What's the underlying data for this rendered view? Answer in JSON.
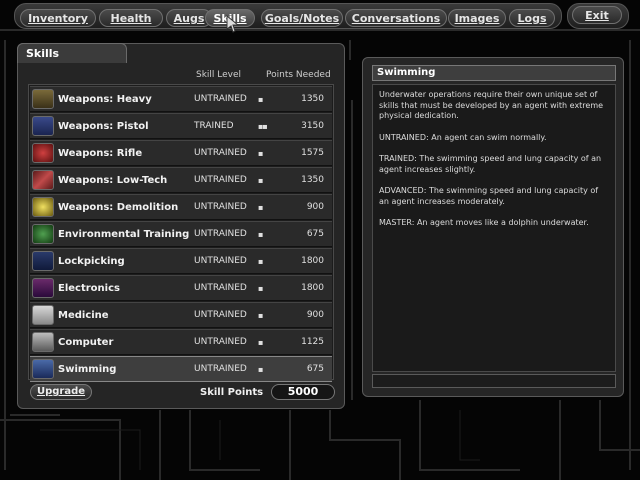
{
  "tabs": [
    {
      "label": "Inventory"
    },
    {
      "label": "Health"
    },
    {
      "label": "Augs"
    },
    {
      "label": "Skills"
    },
    {
      "label": "Goals/Notes"
    },
    {
      "label": "Conversations"
    },
    {
      "label": "Images"
    },
    {
      "label": "Logs"
    }
  ],
  "exit_label": "Exit",
  "skills_panel": {
    "title": "Skills",
    "col_level": "Skill Level",
    "col_points": "Points Needed",
    "rows": [
      {
        "name": "Weapons: Heavy",
        "level": "UNTRAINED",
        "pips": "▪",
        "points": "1350",
        "icon": "heavy-weapon-icon"
      },
      {
        "name": "Weapons: Pistol",
        "level": "TRAINED",
        "pips": "▪▪",
        "points": "3150",
        "icon": "pistol-icon"
      },
      {
        "name": "Weapons: Rifle",
        "level": "UNTRAINED",
        "pips": "▪",
        "points": "1575",
        "icon": "rifle-icon"
      },
      {
        "name": "Weapons: Low-Tech",
        "level": "UNTRAINED",
        "pips": "▪",
        "points": "1350",
        "icon": "knife-icon"
      },
      {
        "name": "Weapons: Demolition",
        "level": "UNTRAINED",
        "pips": "▪",
        "points": "900",
        "icon": "grenade-icon"
      },
      {
        "name": "Environmental Training",
        "level": "UNTRAINED",
        "pips": "▪",
        "points": "675",
        "icon": "hazmat-icon"
      },
      {
        "name": "Lockpicking",
        "level": "UNTRAINED",
        "pips": "▪",
        "points": "1800",
        "icon": "lockpick-icon"
      },
      {
        "name": "Electronics",
        "level": "UNTRAINED",
        "pips": "▪",
        "points": "1800",
        "icon": "circuit-icon"
      },
      {
        "name": "Medicine",
        "level": "UNTRAINED",
        "pips": "▪",
        "points": "900",
        "icon": "medkit-icon"
      },
      {
        "name": "Computer",
        "level": "UNTRAINED",
        "pips": "▪",
        "points": "1125",
        "icon": "computer-icon"
      },
      {
        "name": "Swimming",
        "level": "UNTRAINED",
        "pips": "▪",
        "points": "675",
        "icon": "swimmer-icon"
      }
    ],
    "upgrade_label": "Upgrade",
    "skill_points_label": "Skill Points",
    "skill_points_value": "5000"
  },
  "description": {
    "title": "Swimming",
    "paragraphs": [
      "Underwater operations require their own unique set of skills that must be developed by an agent with extreme physical dedication.",
      "UNTRAINED: An agent can swim normally.",
      "TRAINED: The swimming speed and lung capacity of an agent increases slightly.",
      "ADVANCED:  The swimming speed and lung capacity of an agent increases moderately.",
      "MASTER: An agent moves like a dolphin underwater."
    ]
  }
}
